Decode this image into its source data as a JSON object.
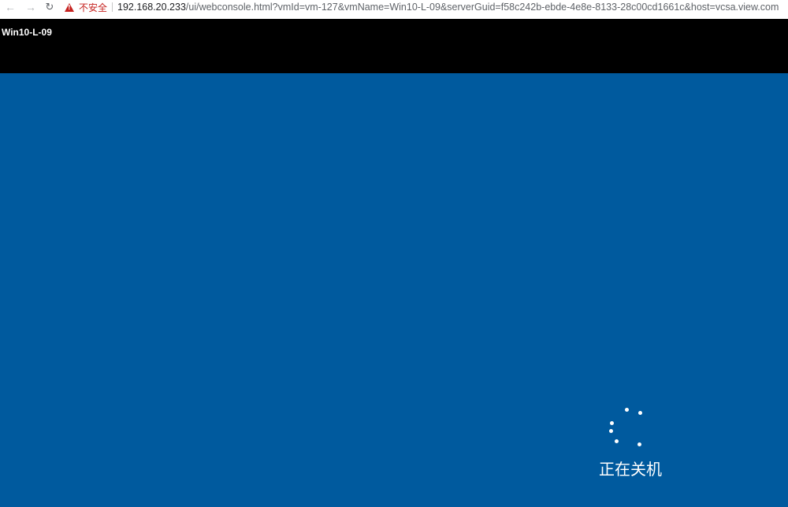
{
  "browser": {
    "back_icon": "arrow-left-icon",
    "forward_icon": "arrow-right-icon",
    "reload_icon": "reload-icon",
    "security_warning": "不安全",
    "url_host": "192.168.20.233",
    "url_path": "/ui/webconsole.html?vmId=vm-127&vmName=Win10-L-09&serverGuid=f58c242b-ebde-4e8e-8133-28c00cd1661c&host=vcsa.view.com"
  },
  "console": {
    "vm_name": "Win10-L-09",
    "screen_color": "#005a9e",
    "status_text": "正在关机",
    "spinner_icon": "loading-spinner-icon"
  }
}
